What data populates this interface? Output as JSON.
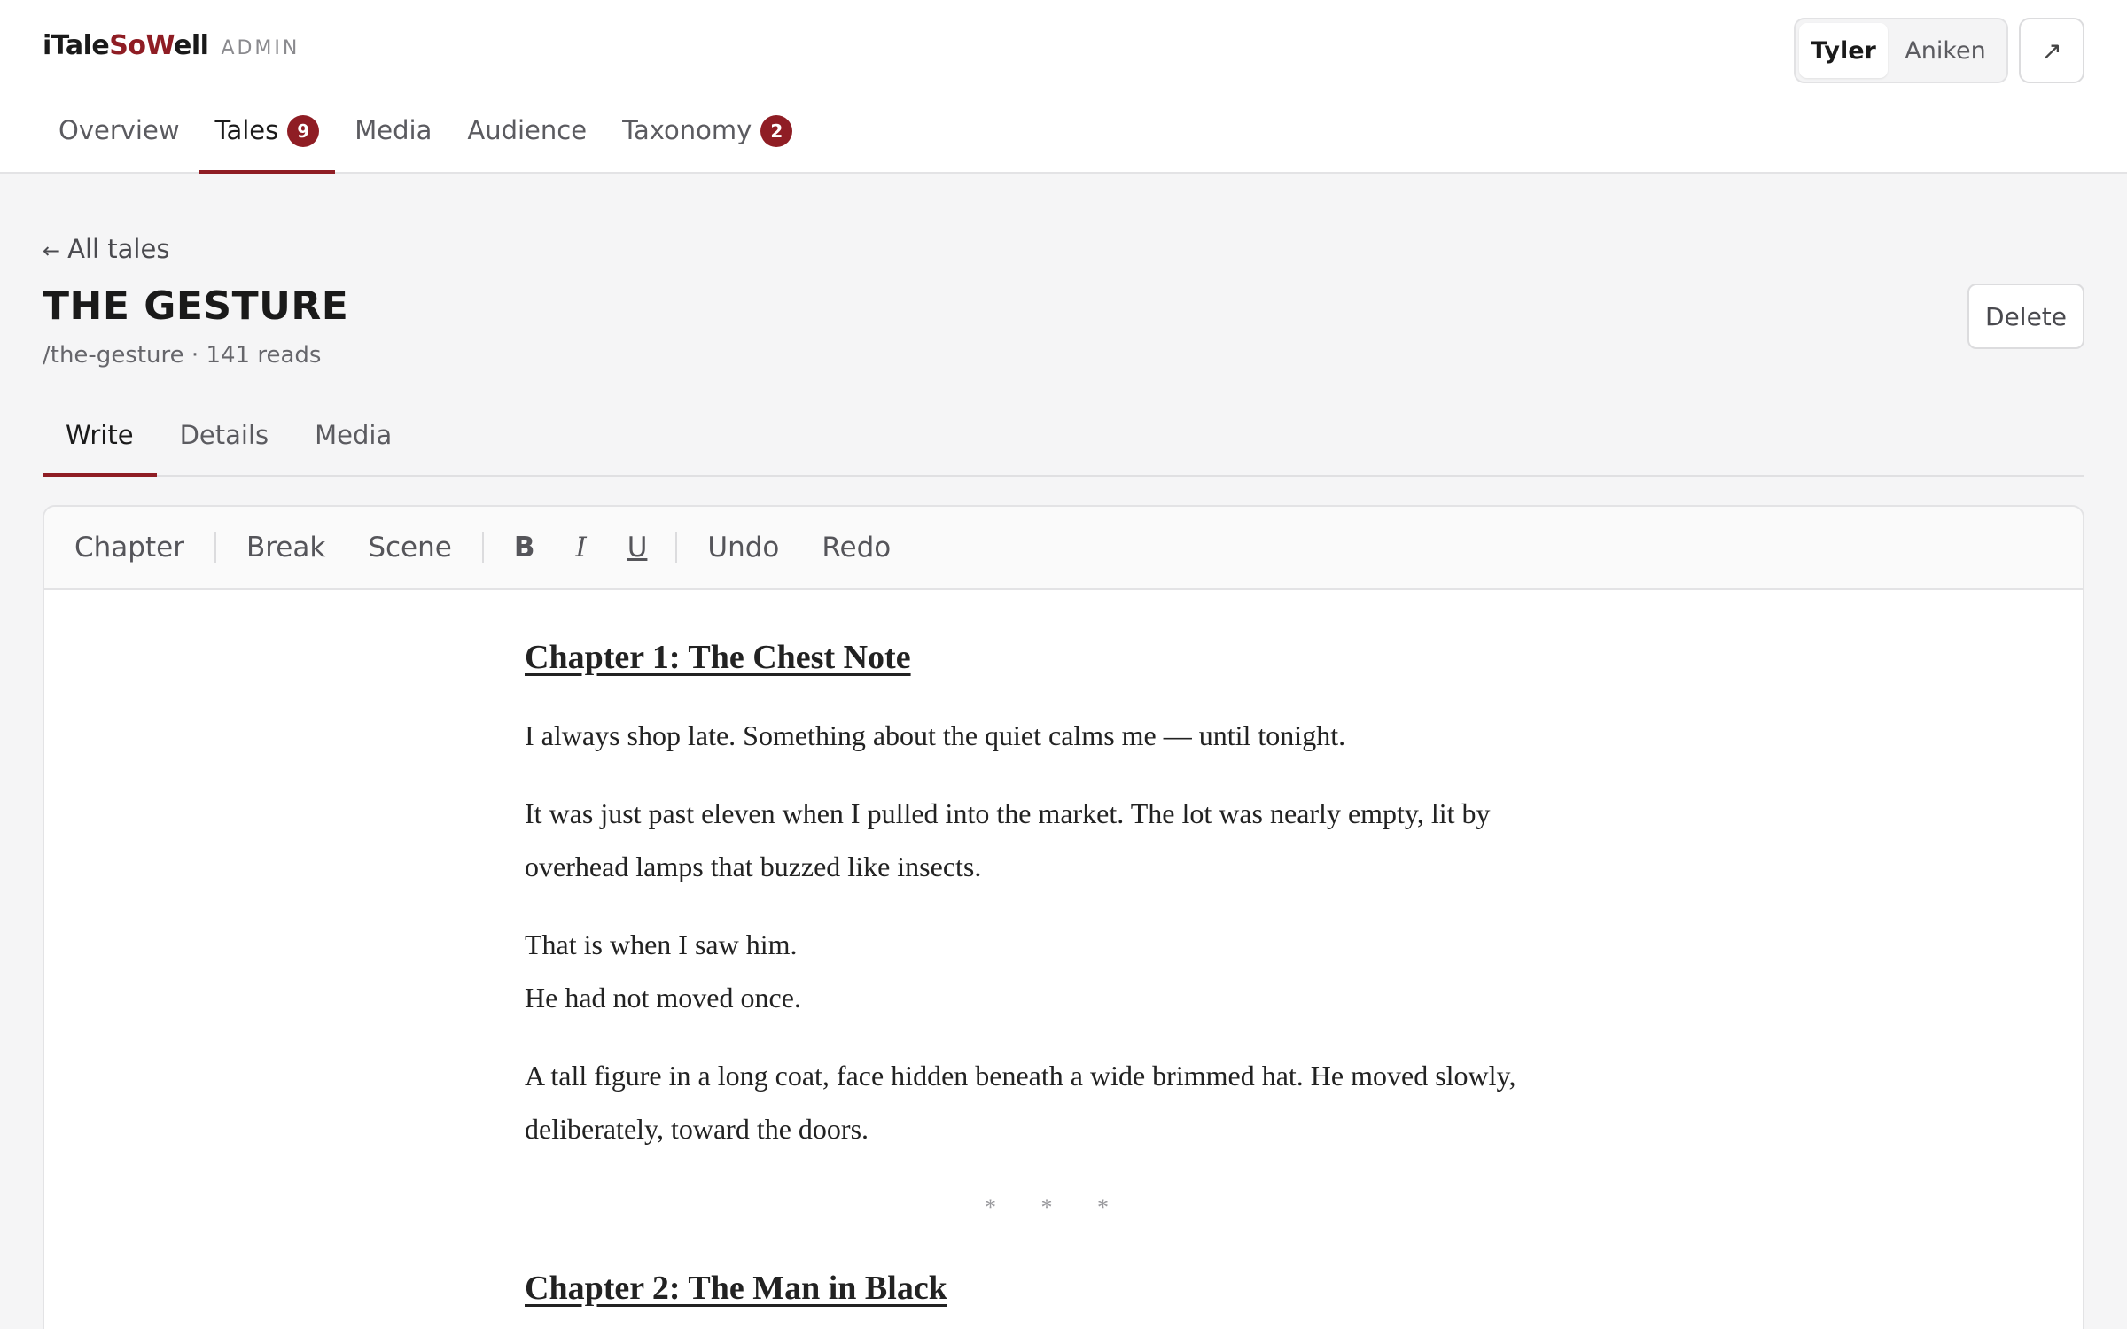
{
  "brand": {
    "name_prefix": "iTale",
    "name_accent": "So",
    "name_accent2": "W",
    "name_suffix": "ell",
    "admin_label": "ADMIN"
  },
  "nav": {
    "items": [
      {
        "label": "Overview",
        "badge": ""
      },
      {
        "label": "Tales",
        "badge": "9"
      },
      {
        "label": "Media",
        "badge": ""
      },
      {
        "label": "Audience",
        "badge": ""
      },
      {
        "label": "Taxonomy",
        "badge": "2"
      }
    ],
    "active": "Tales"
  },
  "users": {
    "active": "Tyler",
    "other": "Aniken"
  },
  "external_icon": "↗",
  "back": {
    "arrow": "←",
    "label": "All tales"
  },
  "tale": {
    "title": "THE GESTURE",
    "meta": "/the-gesture · 141 reads"
  },
  "delete_label": "Delete",
  "subtabs": {
    "items": [
      "Write",
      "Details",
      "Media"
    ],
    "active": "Write"
  },
  "toolbar": {
    "chapter": "Chapter",
    "break": "Break",
    "scene": "Scene",
    "bold": "B",
    "italic": "I",
    "underline": "U",
    "undo": "Undo",
    "redo": "Redo"
  },
  "document": {
    "chapter1_title": "Chapter 1: The Chest Note",
    "p1": "I always shop late. Something about the quiet calms me — until tonight.",
    "p2": "It was just past eleven when I pulled into the market. The lot was nearly empty, lit by overhead lamps that buzzed like insects.",
    "p3_line1": "That is when I saw him.",
    "p3_line2": "He had not moved once.",
    "p4": "A tall figure in a long coat, face hidden beneath a wide brimmed hat. He moved slowly, deliberately, toward the doors.",
    "scene_break": "* * *",
    "chapter2_title": "Chapter 2: The Man in Black"
  },
  "colors": {
    "accent": "#8f1d24",
    "background": "#f5f5f6"
  }
}
